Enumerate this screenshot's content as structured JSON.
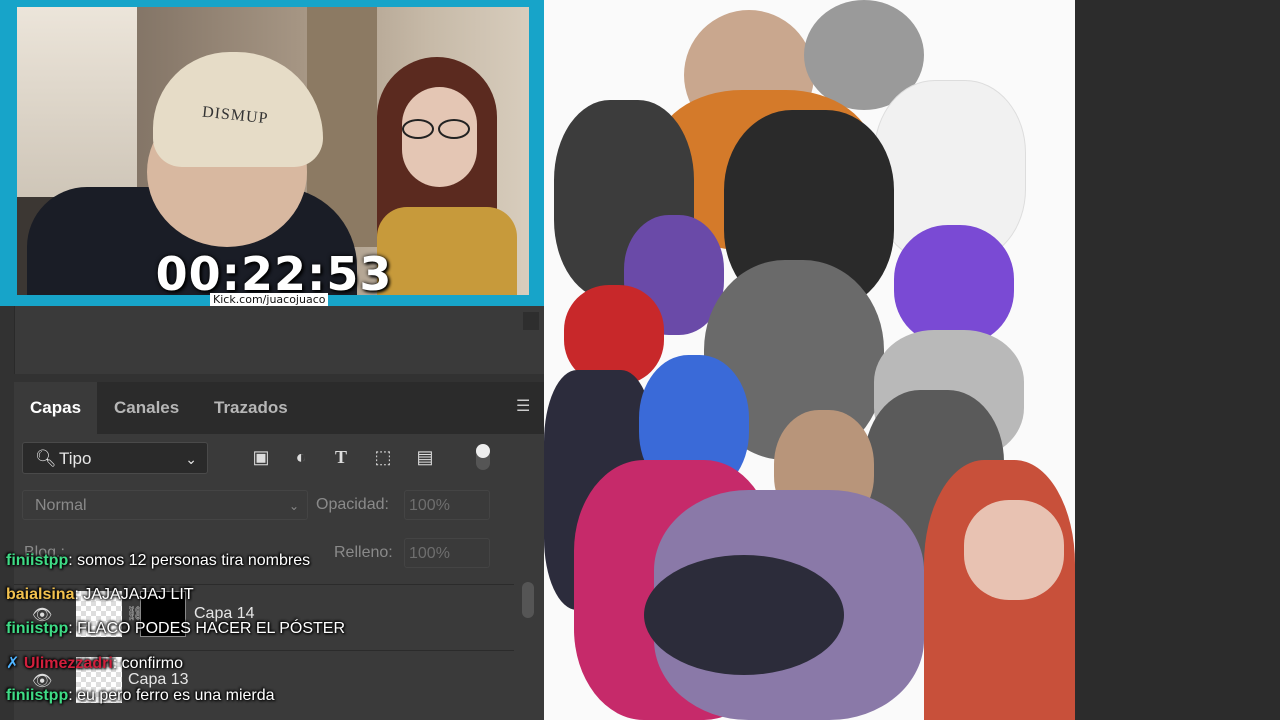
{
  "stream": {
    "timer": "00:22:53",
    "url": "Kick.com/juacojuaco",
    "cap_text": "DISMUP"
  },
  "layers_panel": {
    "tabs": [
      "Capas",
      "Canales",
      "Trazados"
    ],
    "active_tab": "Capas",
    "filter": {
      "label": "Tipo",
      "icon": "search-icon"
    },
    "tools": [
      "image-filter-icon",
      "adjustment-filter-icon",
      "type-filter-icon",
      "shape-filter-icon",
      "smart-object-filter-icon"
    ],
    "blend_mode": "Normal",
    "opacity_label": "Opacidad:",
    "opacity_value": "100%",
    "lock_label": "Bloq.:",
    "fill_label": "Relleno:",
    "fill_value": "100%",
    "layers": [
      {
        "name": "Capa 14"
      },
      {
        "name": "Capa 13"
      }
    ]
  },
  "chat": [
    {
      "user": "finiistpp",
      "user_color": "#3fdc86",
      "text": "somos 12 personas tira nombres"
    },
    {
      "user": "baialsina",
      "user_color": "#f2c14e",
      "text": "JAJAJAJAJ LIT"
    },
    {
      "user": "finiistpp",
      "user_color": "#3fdc86",
      "text": "FLACO PODES HACER EL PÓSTER"
    },
    {
      "user": "Ulimezzadri",
      "user_color": "#d21f3c",
      "text": "confirmo",
      "badge": "✗"
    },
    {
      "user": "finiistpp",
      "user_color": "#3fdc86",
      "text": "eu pero ferro es una mierda"
    }
  ],
  "colors": {
    "webcam_border": "#17a4c9",
    "ps_bg": "#323232",
    "poster_bg": "#fafafa"
  }
}
